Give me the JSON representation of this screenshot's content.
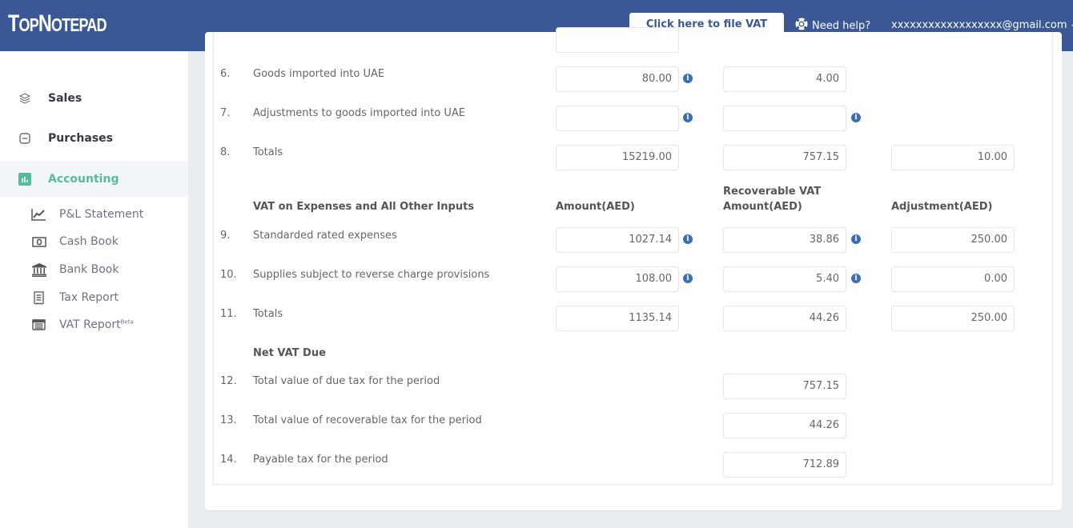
{
  "header": {
    "logo": "TopNotepad",
    "logo_parts": [
      "T",
      "OP",
      "N",
      "OTEPAD"
    ],
    "file_vat_button": "Click here to file VAT return",
    "help_label": "Need help?",
    "user_email": "xxxxxxxxxxxxxxxxxx@gmail.com",
    "brand_color": "#3a5896"
  },
  "sidebar": {
    "items": [
      {
        "label": "Sales",
        "icon": "layers-icon"
      },
      {
        "label": "Purchases",
        "icon": "minus-square-icon"
      },
      {
        "label": "Accounting",
        "icon": "bar-chart-icon",
        "active": true
      }
    ],
    "subitems": [
      {
        "label": "P&L Statement",
        "icon": "line-chart-icon"
      },
      {
        "label": "Cash Book",
        "icon": "money-icon"
      },
      {
        "label": "Bank Book",
        "icon": "bank-icon"
      },
      {
        "label": "Tax Report",
        "icon": "receipt-icon"
      },
      {
        "label": "VAT Report",
        "badge": "Beta",
        "icon": "list-alt-icon"
      }
    ],
    "accent_color": "#57b99e"
  },
  "form": {
    "imports_rows": [
      {
        "num": "6.",
        "desc": "Goods imported into UAE",
        "amount": "80.00",
        "vat": "4.00",
        "adjustment": null
      },
      {
        "num": "7.",
        "desc": "Adjustments to goods imported into UAE",
        "amount": "",
        "vat": "",
        "adjustment": null
      },
      {
        "num": "8.",
        "desc": "Totals",
        "amount": "15219.00",
        "vat": "757.15",
        "adjustment": "10.00"
      }
    ],
    "expenses_section": {
      "title": "VAT on Expenses and All Other Inputs",
      "col_amount": "Amount(AED)",
      "col_vat_line1": "Recoverable VAT",
      "col_vat_line2": "Amount(AED)",
      "col_adjustment": "Adjustment(AED)",
      "rows": [
        {
          "num": "9.",
          "desc": "Standarded rated expenses",
          "amount": "1027.14",
          "vat": "38.86",
          "adjustment": "250.00"
        },
        {
          "num": "10.",
          "desc": "Supplies subject to reverse charge provisions",
          "amount": "108.00",
          "vat": "5.40",
          "adjustment": "0.00"
        },
        {
          "num": "11.",
          "desc": "Totals",
          "amount": "1135.14",
          "vat": "44.26",
          "adjustment": "250.00"
        }
      ]
    },
    "net_section": {
      "title": "Net VAT Due",
      "rows": [
        {
          "num": "12.",
          "desc": "Total value of due tax for the period",
          "value": "757.15"
        },
        {
          "num": "13.",
          "desc": "Total value of recoverable tax for the period",
          "value": "44.26"
        },
        {
          "num": "14.",
          "desc": "Payable tax for the period",
          "value": "712.89"
        }
      ]
    },
    "info_icon_glyph": "i"
  }
}
